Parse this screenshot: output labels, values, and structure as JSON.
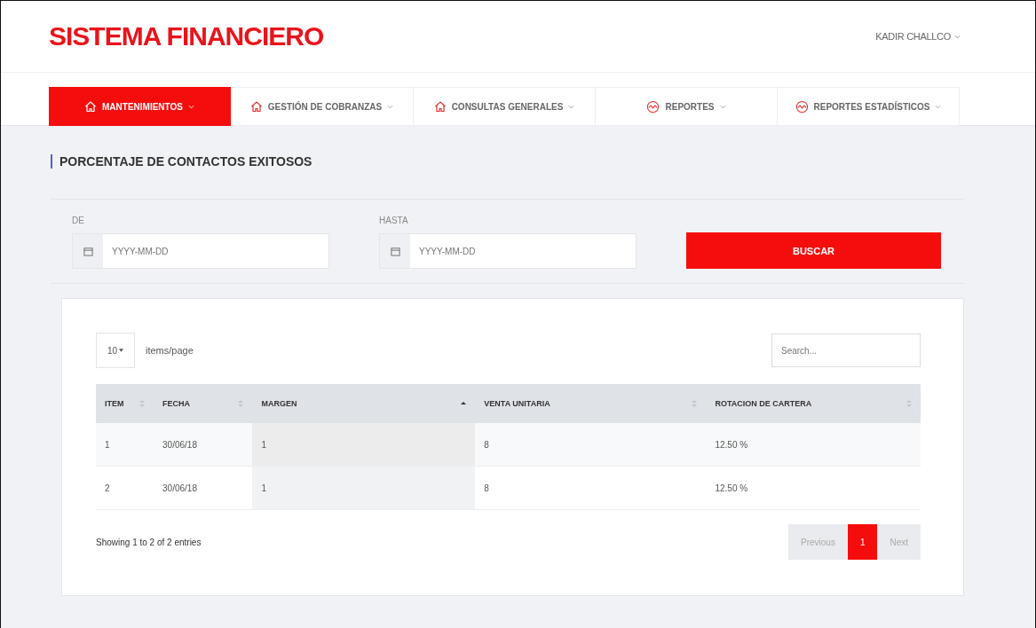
{
  "header": {
    "logo": "SISTEMA FINANCIERO",
    "user": "KADIR CHALLCO"
  },
  "nav": [
    {
      "label": "MANTENIMIENTOS",
      "kind": "house",
      "selected": true
    },
    {
      "label": "GESTIÓN DE COBRANZAS",
      "kind": "house",
      "selected": false
    },
    {
      "label": "CONSULTAS GENERALES",
      "kind": "house",
      "selected": false
    },
    {
      "label": "REPORTES",
      "kind": "wave",
      "selected": false
    },
    {
      "label": "REPORTES ESTADÍSTICOS",
      "kind": "wave",
      "selected": false
    }
  ],
  "page_title": "PORCENTAJE DE CONTACTOS EXITOSOS",
  "filters": [
    {
      "label": "DE",
      "placeholder": "YYYY-MM-DD"
    },
    {
      "label": "HASTA",
      "placeholder": "YYYY-MM-DD"
    }
  ],
  "search_button": "BUSCAR",
  "table": {
    "page_size": "10",
    "page_size_label": "items/page",
    "search_placeholder": "Search...",
    "columns": [
      {
        "label": "ITEM",
        "sorted": false
      },
      {
        "label": "FECHA",
        "sorted": false
      },
      {
        "label": "MARGEN",
        "sorted": true
      },
      {
        "label": "VENTA UNITARIA",
        "sorted": false
      },
      {
        "label": "ROTACION DE CARTERA",
        "sorted": false
      }
    ],
    "rows": [
      [
        "1",
        "30/06/18",
        "1",
        "8",
        "12.50 %"
      ],
      [
        "2",
        "30/06/18",
        "1",
        "8",
        "12.50 %"
      ]
    ],
    "info": "Showing 1 to 2 of 2 entries",
    "pagination": [
      {
        "label": "Previous",
        "selected": false,
        "disabled": true
      },
      {
        "label": "1",
        "selected": true,
        "disabled": false
      },
      {
        "label": "Next",
        "selected": false,
        "disabled": true
      }
    ]
  }
}
